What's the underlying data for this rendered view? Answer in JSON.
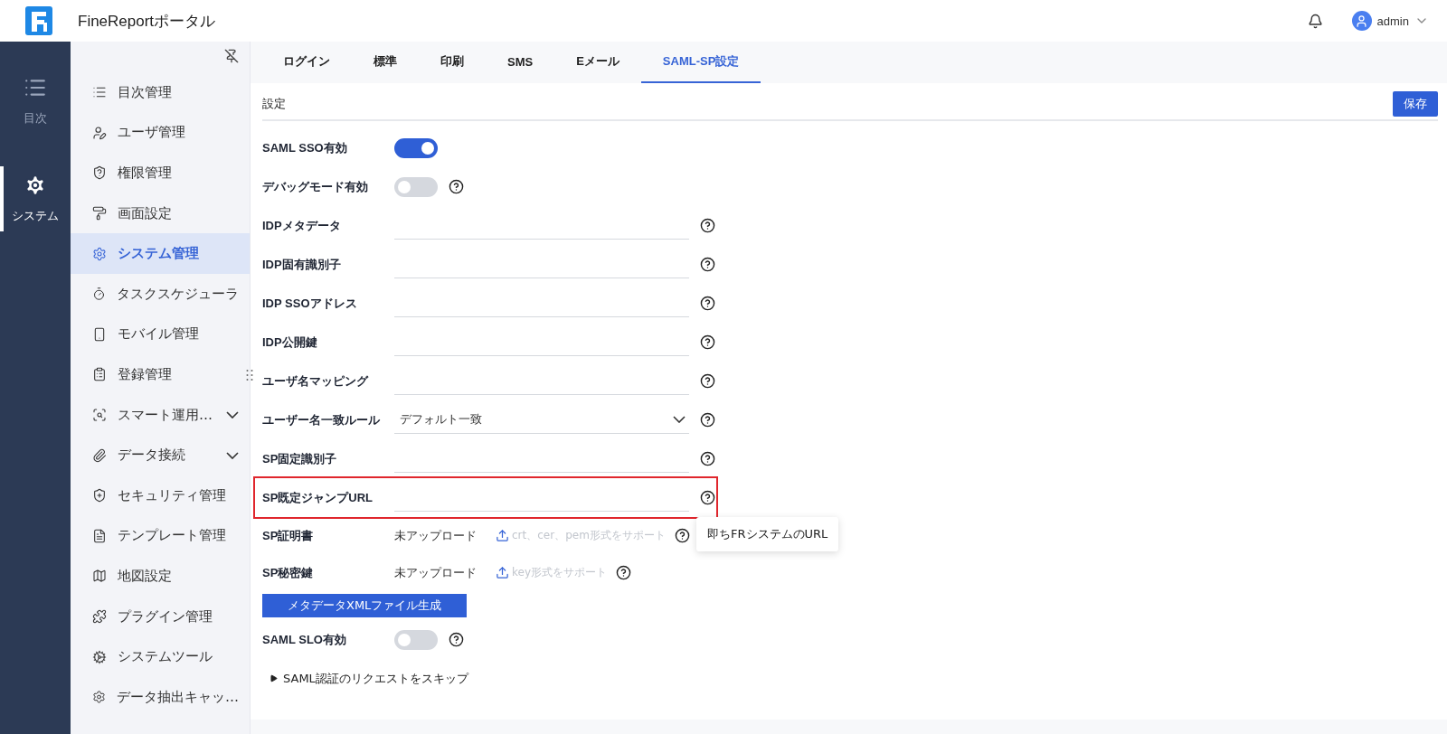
{
  "header": {
    "title": "FineReportポータル",
    "user": "admin"
  },
  "rail": [
    {
      "label": "目次",
      "selected": false
    },
    {
      "label": "システム",
      "selected": true
    }
  ],
  "sidebar": {
    "items": [
      {
        "label": "目次管理",
        "selected": false
      },
      {
        "label": "ユーザ管理",
        "selected": false
      },
      {
        "label": "権限管理",
        "selected": false
      },
      {
        "label": "画面設定",
        "selected": false
      },
      {
        "label": "システム管理",
        "selected": true
      },
      {
        "label": "タスクスケジューラ",
        "selected": false
      },
      {
        "label": "モバイル管理",
        "selected": false
      },
      {
        "label": "登録管理",
        "selected": false
      },
      {
        "label": "スマート運用…",
        "selected": false,
        "expanded": false
      },
      {
        "label": "データ接続",
        "selected": false,
        "expanded": false
      },
      {
        "label": "セキュリティ管理",
        "selected": false
      },
      {
        "label": "テンプレート管理",
        "selected": false
      },
      {
        "label": "地図設定",
        "selected": false
      },
      {
        "label": "プラグイン管理",
        "selected": false
      },
      {
        "label": "システムツール",
        "selected": false
      },
      {
        "label": "データ抽出キャッ…",
        "selected": false
      }
    ]
  },
  "tabs": [
    {
      "label": "ログイン",
      "selected": false
    },
    {
      "label": "標準",
      "selected": false
    },
    {
      "label": "印刷",
      "selected": false
    },
    {
      "label": "SMS",
      "selected": false
    },
    {
      "label": "Eメール",
      "selected": false
    },
    {
      "label": "SAML-SP設定",
      "selected": true
    }
  ],
  "section": {
    "title": "設定",
    "save_button": "保存"
  },
  "rows": [
    {
      "kind": "toggle",
      "label": "SAML SSO有効",
      "on": true,
      "help": false
    },
    {
      "kind": "toggle",
      "label": "デバッグモード有効",
      "on": false,
      "help": true
    },
    {
      "kind": "text",
      "label": "IDPメタデータ",
      "help": true
    },
    {
      "kind": "text",
      "label": "IDP固有識別子",
      "help": true
    },
    {
      "kind": "text",
      "label": "IDP SSOアドレス",
      "help": true
    },
    {
      "kind": "text",
      "label": "IDP公開鍵",
      "help": true
    },
    {
      "kind": "text",
      "label": "ユーザ名マッピング",
      "help": true
    },
    {
      "kind": "select",
      "label": "ユーザー名一致ルール",
      "value": "デフォルト一致",
      "help": true
    },
    {
      "kind": "text",
      "label": "SP固定識別子",
      "help": true
    },
    {
      "kind": "text",
      "label": "SP既定ジャンプURL",
      "help": true,
      "highlighted": true,
      "tooltip": "即ちFRシステムのURL"
    },
    {
      "kind": "upload",
      "label": "SP証明書",
      "status": "未アップロード",
      "hint": "crt、cer、pem形式をサポート",
      "help": true
    },
    {
      "kind": "upload",
      "label": "SP秘密鍵",
      "status": "未アップロード",
      "hint": "key形式をサポート",
      "help": true
    },
    {
      "kind": "button",
      "label": "メタデータXMLファイル生成"
    },
    {
      "kind": "toggle",
      "label": "SAML SLO有効",
      "on": false,
      "help": true
    },
    {
      "kind": "collapse",
      "label": "SAML認証のリクエストをスキップ",
      "expanded": false
    }
  ]
}
